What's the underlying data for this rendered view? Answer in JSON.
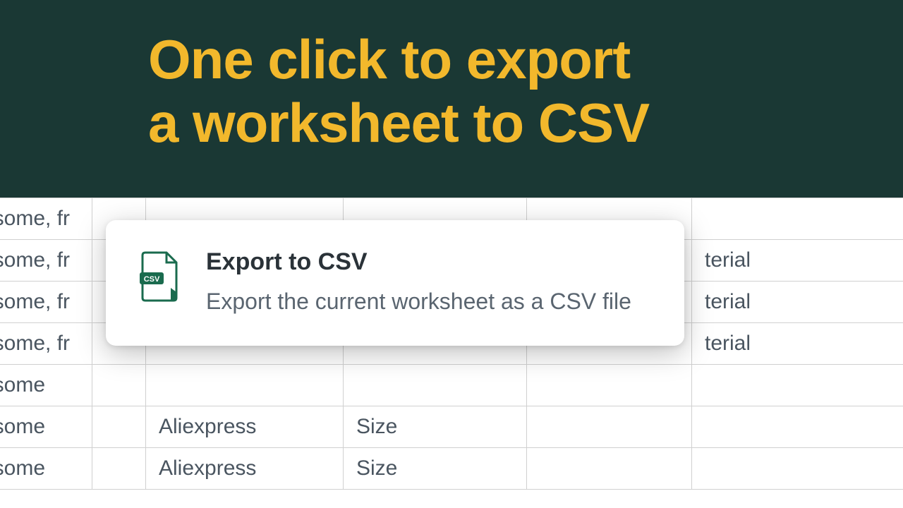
{
  "banner": {
    "headline_line1": "One click to export",
    "headline_line2": "a worksheet to CSV"
  },
  "tooltip": {
    "title": "Export to CSV",
    "description": "Export the current worksheet as a CSV file",
    "icon_badge": "CSV"
  },
  "spreadsheet": {
    "rows": [
      {
        "a": "vesome, fr",
        "b": "",
        "c": "",
        "d": "",
        "e": "",
        "f": ""
      },
      {
        "a": "vesome, fr",
        "b": "",
        "c": "",
        "d": "",
        "e": "",
        "f": "terial"
      },
      {
        "a": "vesome, fr",
        "b": "",
        "c": "",
        "d": "",
        "e": "",
        "f": "terial"
      },
      {
        "a": "vesome, fr",
        "b": "",
        "c": "",
        "d": "",
        "e": "",
        "f": "terial"
      },
      {
        "a": "vesome",
        "b": "",
        "c": "",
        "d": "",
        "e": "",
        "f": ""
      },
      {
        "a": "vesome",
        "b": "",
        "c": "Aliexpress",
        "d": "Size",
        "e": "",
        "f": ""
      },
      {
        "a": "vesome",
        "b": "",
        "c": "Aliexpress",
        "d": "Size",
        "e": "",
        "f": ""
      }
    ]
  }
}
